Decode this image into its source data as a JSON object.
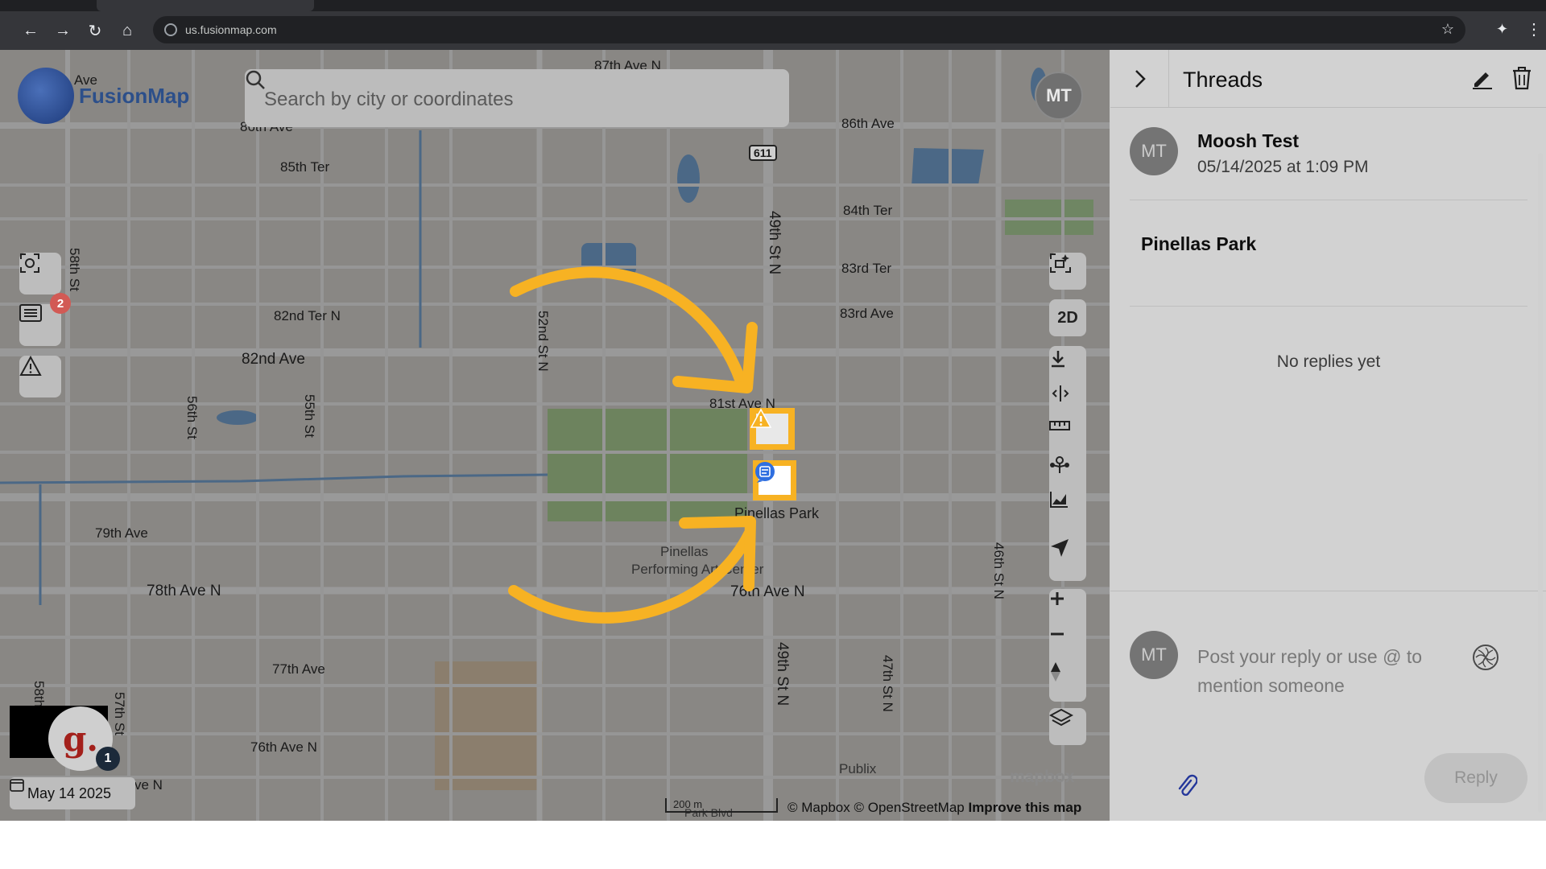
{
  "browser": {
    "url": "us.fusionmap.com"
  },
  "app": {
    "logo_text": "FusionMap",
    "search_placeholder": "Search by city or coordinates",
    "map_avatar_initials": "MT",
    "left_tools": [
      {
        "icon": "scan-icon"
      },
      {
        "icon": "threads-icon",
        "badge": "2"
      },
      {
        "icon": "warning-icon"
      }
    ],
    "right_tools": {
      "view_mode_label": "2D",
      "icons": [
        "ai-capture-icon",
        "download-icon",
        "split-icon",
        "ruler-icon",
        "route-icon",
        "chart-icon",
        "locate-icon",
        "zoom-in-icon",
        "zoom-out-icon",
        "compass-icon",
        "layers-icon"
      ]
    },
    "g_logo_letter": "g.",
    "g_badge": "1",
    "date": "May 14 2025",
    "scale_label": "200 m",
    "attribution": {
      "mapbox": "© Mapbox",
      "osm": "© OpenStreetMap",
      "improve": "Improve this map"
    },
    "mapbox_logo": "mapbox",
    "accent_color": "#f7b223"
  },
  "map_labels": {
    "ave_top": "Ave",
    "s87": "87th Ave N",
    "s86w": "86th Ave",
    "s86e": "86th Ave",
    "s85ter": "85th Ter",
    "s84ter": "84th Ter",
    "s83ter": "83rd Ter",
    "s83ave": "83rd Ave",
    "s82ter": "82nd Ter N",
    "s82ave": "82nd Ave",
    "s81": "81st Ave N",
    "s79": "79th Ave",
    "s78": "78th Ave N",
    "s76e": "76th Ave N",
    "s77": "77th Ave",
    "s76w": "76th Ave N",
    "s75": "ve N",
    "st58": "58th St",
    "st58b": "58th",
    "st57": "57th St",
    "st56": "56th St",
    "st55": "55th St",
    "st52": "52nd St N",
    "st49a": "49th St N",
    "st49b": "49th St N",
    "st47": "47th St N",
    "st46": "46th St N",
    "hw611": "611",
    "poi_park": "Pinellas Park",
    "poi_pac_1": "Pinellas",
    "poi_pac_2": "Performing Art Center",
    "poi_publix": "Publix",
    "park_blvd": "Park Blvd"
  },
  "panel": {
    "title": "Threads",
    "author_initials": "MT",
    "author_name": "Moosh Test",
    "timestamp": "05/14/2025 at 1:09 PM",
    "thread_title": "Pinellas Park",
    "no_replies": "No replies yet",
    "reply_avatar_initials": "MT",
    "reply_placeholder": "Post your reply or use @ to mention someone",
    "reply_button": "Reply"
  }
}
